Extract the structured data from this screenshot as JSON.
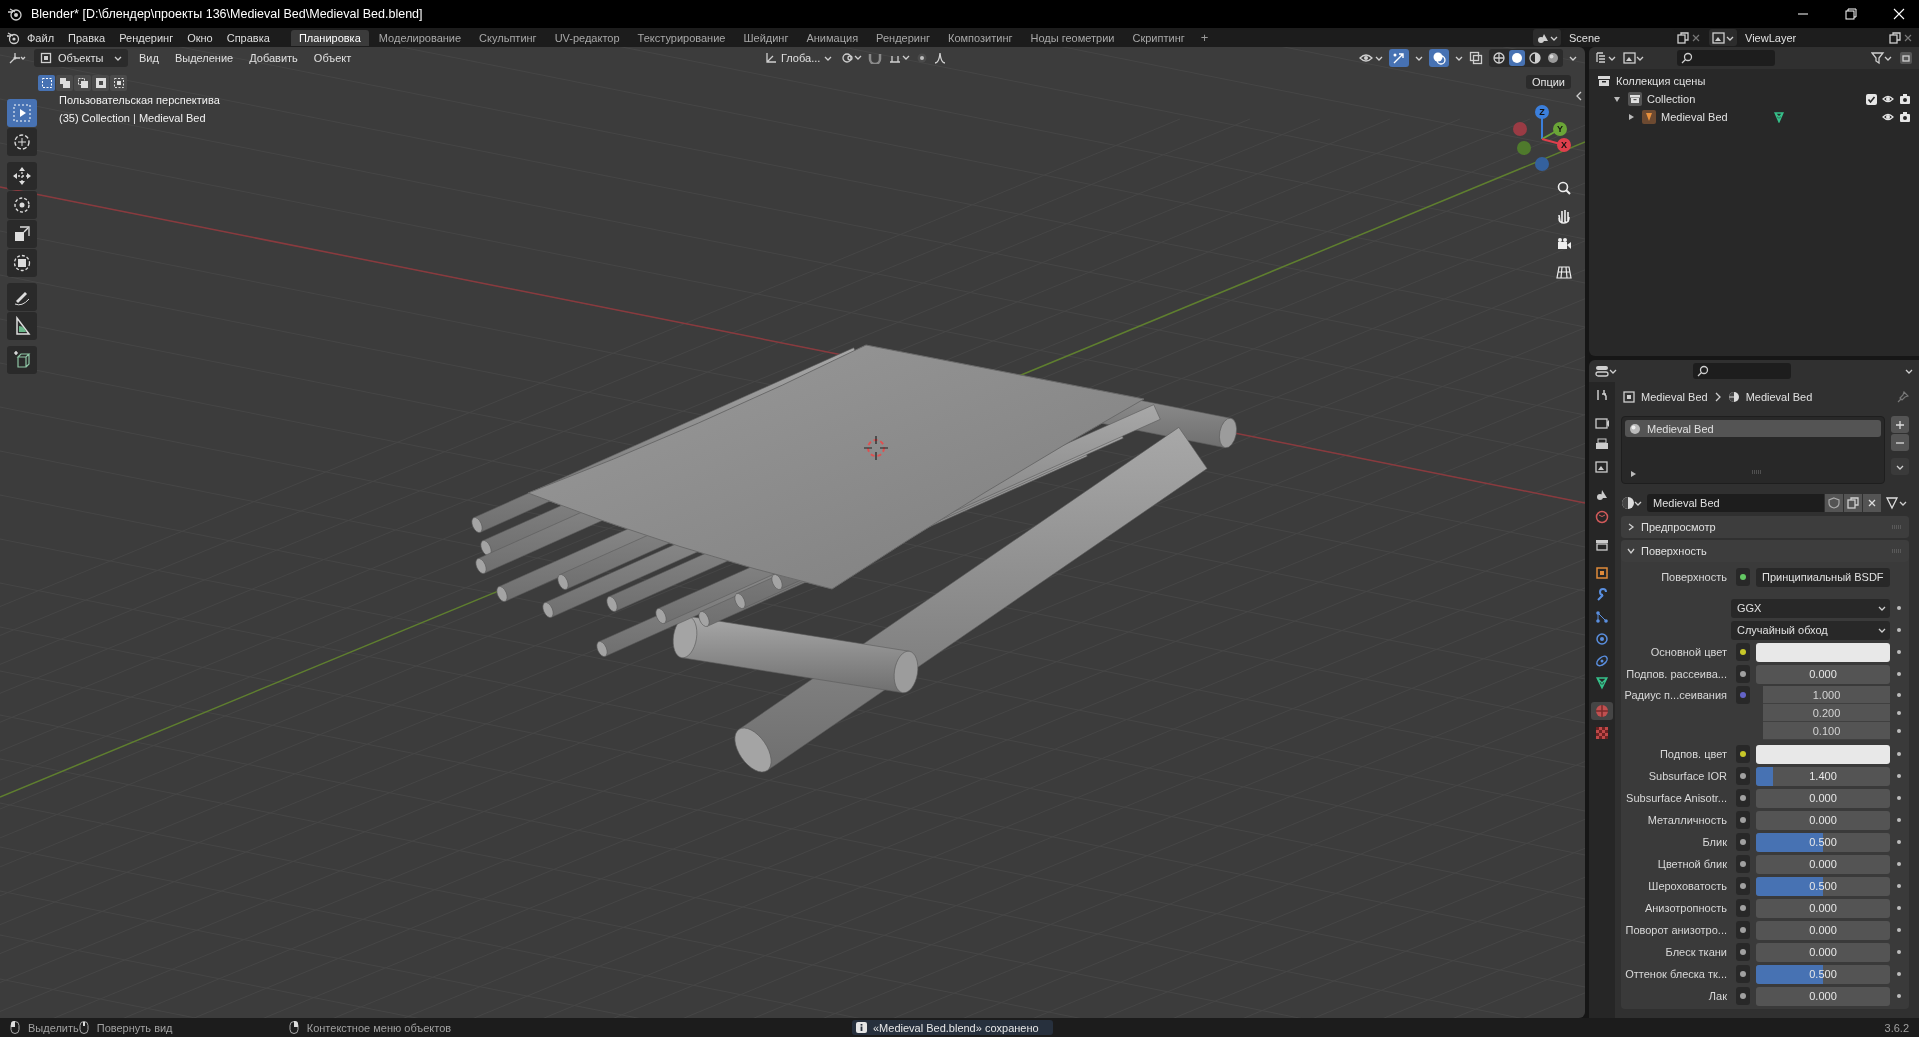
{
  "title_bar": {
    "title": "Blender* [D:\\блендер\\проекты 136\\Medieval Bed\\Medieval Bed.blend]"
  },
  "menu": [
    "Файл",
    "Правка",
    "Рендеринг",
    "Окно",
    "Справка"
  ],
  "workspaces": [
    {
      "label": "Планировка",
      "selected": true
    },
    {
      "label": "Моделирование",
      "selected": false
    },
    {
      "label": "Скульптинг",
      "selected": false
    },
    {
      "label": "UV-редактор",
      "selected": false
    },
    {
      "label": "Текстурирование",
      "selected": false
    },
    {
      "label": "Шейдинг",
      "selected": false
    },
    {
      "label": "Анимация",
      "selected": false
    },
    {
      "label": "Рендеринг",
      "selected": false
    },
    {
      "label": "Композитинг",
      "selected": false
    },
    {
      "label": "Ноды геометрии",
      "selected": false
    },
    {
      "label": "Скриптинг",
      "selected": false
    }
  ],
  "add_workspace": "+",
  "scene": "Scene",
  "view_layer": "ViewLayer",
  "viewport": {
    "mode": "Объекты",
    "menus": [
      "Вид",
      "Выделение",
      "Добавить",
      "Объект"
    ],
    "orientation": "Глоба...",
    "select_modes": [
      {
        "selected": true
      },
      {
        "selected": false
      },
      {
        "selected": false
      },
      {
        "selected": false
      },
      {
        "selected": false
      }
    ],
    "view_name": "Пользовательская перспектива",
    "context": "(35) Collection | Medieval Bed",
    "options": "Опции",
    "tools": [
      {
        "kind": "select",
        "selected": true
      },
      {
        "kind": "cursor",
        "selected": false
      },
      {
        "kind": "move",
        "selected": false
      },
      {
        "kind": "rotate",
        "selected": false
      },
      {
        "kind": "scale",
        "selected": false
      },
      {
        "kind": "transform",
        "selected": false
      },
      {
        "kind": "annotate",
        "selected": false
      },
      {
        "kind": "measure",
        "selected": false
      },
      {
        "kind": "addcube",
        "selected": false
      }
    ],
    "gizmo": [
      {
        "kind": "positive",
        "label": "Z",
        "color": "#3b7fdc"
      },
      {
        "kind": "positive",
        "label": "Y",
        "color": "#6aa537"
      },
      {
        "kind": "positive",
        "label": "X",
        "color": "#de3f4c"
      },
      {
        "kind": "negative",
        "color": "#9a3b44"
      },
      {
        "kind": "negative",
        "color": "#4f7a2c"
      },
      {
        "kind": "negative",
        "color": "#34619e"
      }
    ],
    "shading": [
      {
        "kind": "wireframe",
        "selected": false
      },
      {
        "kind": "solid",
        "selected": true
      },
      {
        "kind": "material",
        "selected": false
      },
      {
        "kind": "rendered",
        "selected": false
      }
    ]
  },
  "outliner": {
    "items": [
      {
        "kind": "scene",
        "label": "Коллекция сцены",
        "children": [
          {
            "kind": "collection",
            "label": "Collection",
            "expanded": true,
            "checked": true,
            "children": [
              {
                "kind": "object",
                "label": "Medieval Bed",
                "expanded": false
              }
            ]
          }
        ]
      }
    ]
  },
  "properties": {
    "tabs": [
      {
        "kind": "tool",
        "selected": false
      },
      {
        "kind": "render",
        "selected": false
      },
      {
        "kind": "output",
        "selected": false
      },
      {
        "kind": "view",
        "selected": false
      },
      {
        "kind": "scene",
        "selected": false
      },
      {
        "kind": "world",
        "selected": false
      },
      {
        "kind": "collection",
        "selected": false
      },
      {
        "kind": "object",
        "selected": false
      },
      {
        "kind": "modifiers",
        "selected": false
      },
      {
        "kind": "particles",
        "selected": false
      },
      {
        "kind": "physics",
        "selected": false
      },
      {
        "kind": "constraints",
        "selected": false
      },
      {
        "kind": "data",
        "selected": false
      },
      {
        "kind": "material",
        "selected": true
      },
      {
        "kind": "texture",
        "selected": false
      }
    ],
    "breadcrumb": [
      "Medieval Bed",
      "Medieval Bed"
    ],
    "slots": [
      {
        "label": "Medieval Bed",
        "selected": true
      }
    ],
    "material_name": "Medieval Bed",
    "panels": [
      {
        "label": "Предпросмотр",
        "expanded": false
      },
      {
        "label": "Поверхность",
        "expanded": true
      }
    ],
    "rows": [
      {
        "kind": "shader",
        "label": "Поверхность",
        "value": "Принципиальный BSDF"
      },
      {
        "kind": "dropdown",
        "value": "GGX"
      },
      {
        "kind": "dropdown",
        "value": "Случайный обход"
      },
      {
        "kind": "color",
        "label": "Основной цвет",
        "color": "#e8e8e8"
      },
      {
        "kind": "slider",
        "label": "Подпов. рассеива...",
        "value": "0.000",
        "level": 0
      },
      {
        "kind": "vector",
        "label": "Радиус п...сеивания",
        "values": [
          "1.000",
          "0.200",
          "0.100"
        ]
      },
      {
        "kind": "color",
        "label": "Подпов. цвет",
        "color": "#e8e8e8"
      },
      {
        "kind": "slider",
        "label": "Subsurface IOR",
        "value": "1.400",
        "level": 0.13
      },
      {
        "kind": "slider",
        "label": "Subsurface Anisotr...",
        "value": "0.000",
        "level": 0
      },
      {
        "kind": "slider",
        "label": "Металличность",
        "value": "0.000",
        "level": 0
      },
      {
        "kind": "slider",
        "label": "Блик",
        "value": "0.500",
        "level": 0.5
      },
      {
        "kind": "slider",
        "label": "Цветной блик",
        "value": "0.000",
        "level": 0
      },
      {
        "kind": "slider",
        "label": "Шероховатость",
        "value": "0.500",
        "level": 0.5
      },
      {
        "kind": "slider",
        "label": "Анизотропность",
        "value": "0.000",
        "level": 0
      },
      {
        "kind": "slider",
        "label": "Поворот анизотро...",
        "value": "0.000",
        "level": 0
      },
      {
        "kind": "slider",
        "label": "Блеск ткани",
        "value": "0.000",
        "level": 0
      },
      {
        "kind": "slider",
        "label": "Оттенок блеска тк...",
        "value": "0.500",
        "level": 0.5
      },
      {
        "kind": "slider",
        "label": "Лак",
        "value": "0.000",
        "level": 0
      }
    ]
  },
  "status_bar": {
    "hints": [
      {
        "kind": "left",
        "label": "Выделить"
      },
      {
        "kind": "middle",
        "label": "Повернуть вид"
      },
      {
        "kind": "right",
        "label": "Контекстное меню объектов"
      }
    ],
    "message": "«Medieval Bed.blend» сохранено",
    "version": "3.6.2"
  }
}
